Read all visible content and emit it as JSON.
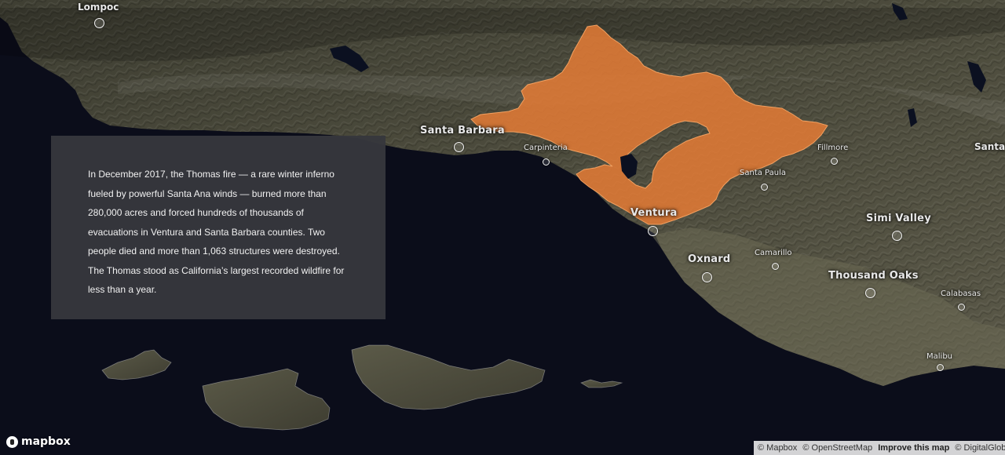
{
  "info": {
    "text": "In December 2017, the Thomas fire — a rare winter inferno fueled by powerful Santa Ana winds — burned more than 280,000 acres and forced hundreds of thousands of evacuations in Ventura and Santa Barbara counties. Two people died and more than 1,063 structures were destroyed. The Thomas stood as California’s largest recorded wildfire for less than a year."
  },
  "places": {
    "lompoc": "Lompoc",
    "santa_barbara": "Santa Barbara",
    "carpinteria": "Carpinteria",
    "ventura": "Ventura",
    "santa_paula": "Santa Paula",
    "fillmore": "Fillmore",
    "santa_clarita": "Santa",
    "oxnard": "Oxnard",
    "camarillo": "Camarillo",
    "simi_valley": "Simi Valley",
    "thousand_oaks": "Thousand Oaks",
    "calabasas": "Calabasas",
    "malibu": "Malibu"
  },
  "fire": {
    "name": "Thomas fire",
    "color": "#e07a36"
  },
  "colors": {
    "ocean": "#0b0d1a",
    "land": "#4a4a3a",
    "panel": "#36373c"
  },
  "logo": {
    "text": "mapbox"
  },
  "attribution": {
    "mapbox": "© Mapbox",
    "osm": "© OpenStreetMap",
    "improve": "Improve this map",
    "dg": "© DigitalGlobe"
  }
}
